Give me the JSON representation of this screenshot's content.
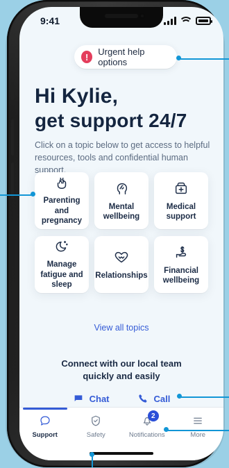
{
  "status": {
    "time": "9:41"
  },
  "urgent": {
    "label": "Urgent help options",
    "icon": "exclamation-circle-icon"
  },
  "greeting": {
    "line1": "Hi Kylie,",
    "line2": "get support 24/7"
  },
  "description": "Click on a topic below to get access to helpful resources, tools and confidential human support.",
  "topics": [
    {
      "label": "Parenting and pregnancy",
      "icon": "baby-hands-icon"
    },
    {
      "label": "Mental wellbeing",
      "icon": "head-brain-icon"
    },
    {
      "label": "Medical support",
      "icon": "medical-bag-icon"
    },
    {
      "label": "Manage fatigue and sleep",
      "icon": "moon-sparkle-icon"
    },
    {
      "label": "Relationships",
      "icon": "heart-handshake-icon"
    },
    {
      "label": "Financial wellbeing",
      "icon": "money-hand-icon"
    }
  ],
  "view_all": "View all topics",
  "connect": {
    "line1": "Connect with our local team",
    "line2": "quickly and easily",
    "chat": "Chat",
    "call": "Call"
  },
  "tabs": [
    {
      "label": "Support",
      "icon": "chat-bubble-icon",
      "active": true
    },
    {
      "label": "Safety",
      "icon": "shield-check-icon",
      "active": false
    },
    {
      "label": "Notifications",
      "icon": "bell-icon",
      "active": false,
      "badge": "2"
    },
    {
      "label": "More",
      "icon": "menu-icon",
      "active": false
    }
  ],
  "colors": {
    "background": "#9bd0e6",
    "screen": "#f1f7fb",
    "accent": "#345bd6",
    "danger": "#e43d5c",
    "callout": "#1296d6"
  }
}
